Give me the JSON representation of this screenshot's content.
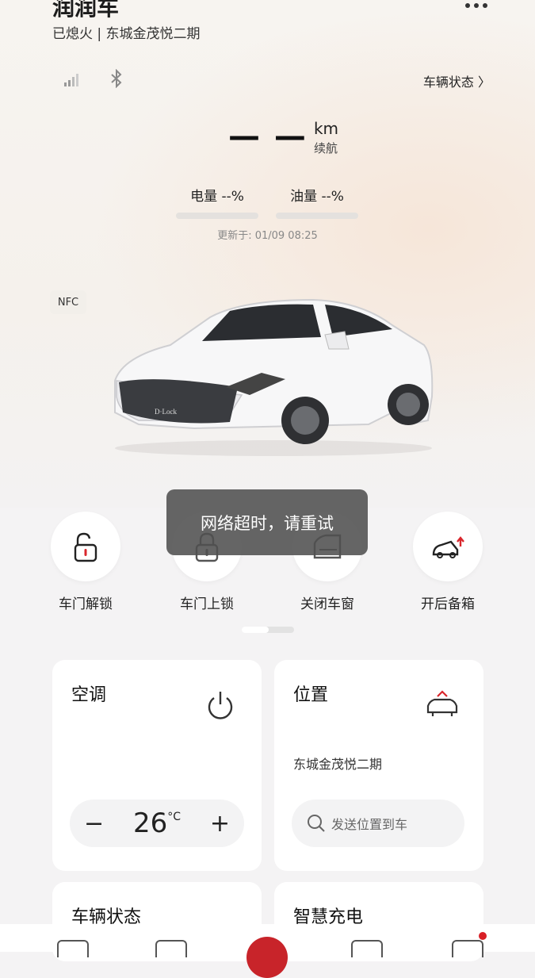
{
  "header": {
    "title": "润润车",
    "subtitle": "已熄火 | 东城金茂悦二期",
    "vehicle_status_link": "车辆状态 〉"
  },
  "dashboard": {
    "range_value": "— —",
    "range_unit": "km",
    "range_label": "续航",
    "battery_label": "电量 --%",
    "fuel_label": "油量 --%",
    "updated": "更新于: 01/09 08:25",
    "nfc": "NFC"
  },
  "toast": "网络超时，请重试",
  "actions": [
    {
      "label": "车门解锁",
      "icon": "unlock-icon"
    },
    {
      "label": "车门上锁",
      "icon": "lock-icon"
    },
    {
      "label": "关闭车窗",
      "icon": "window-icon"
    },
    {
      "label": "开后备箱",
      "icon": "trunk-icon"
    }
  ],
  "cards": {
    "ac": {
      "title": "空调",
      "temperature": "26",
      "unit": "°C",
      "minus": "−",
      "plus": "+"
    },
    "location": {
      "title": "位置",
      "address": "东城金茂悦二期",
      "send_placeholder": "发送位置到车"
    },
    "vehicle_status": {
      "title": "车辆状态"
    },
    "smart_charge": {
      "title": "智慧充电"
    }
  },
  "colors": {
    "accent": "#c8242a",
    "unlock_red": "#d9262c"
  }
}
